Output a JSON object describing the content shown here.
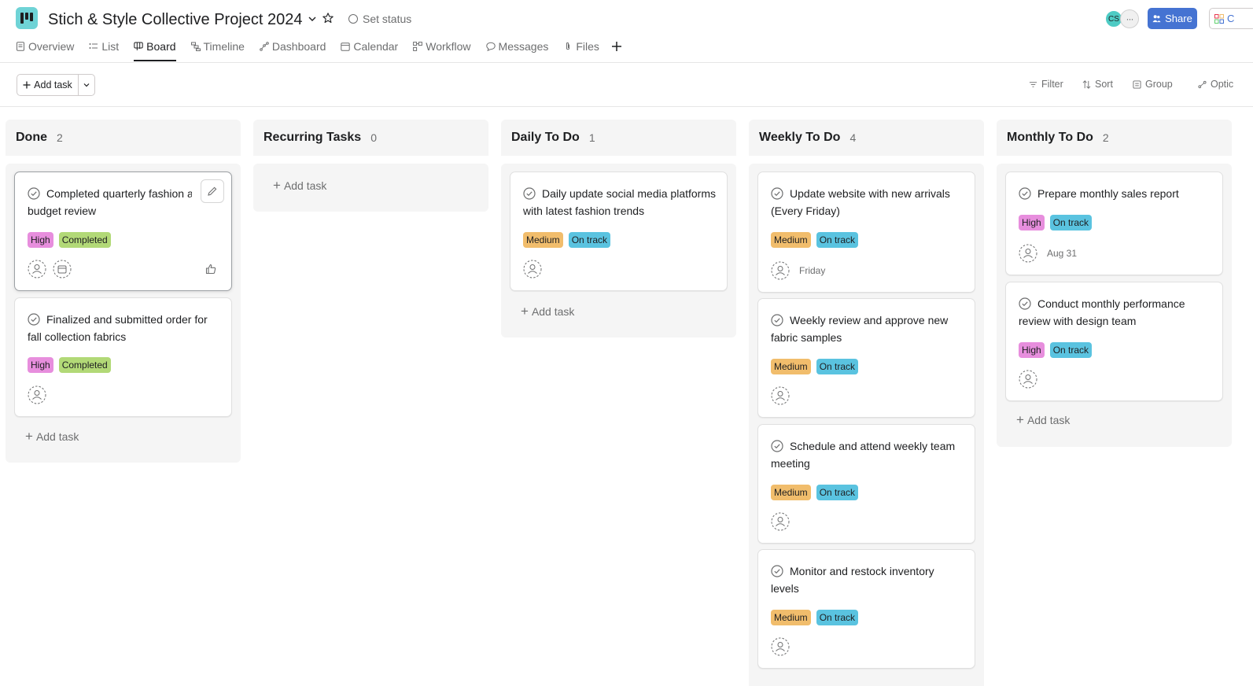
{
  "header": {
    "title": "Stich & Style Collective Project 2024",
    "set_status": "Set status",
    "avatar_initials": "CS",
    "share_label": "Share",
    "customize_label": "C"
  },
  "tabs": [
    {
      "label": "Overview",
      "icon": "overview-icon",
      "active": false
    },
    {
      "label": "List",
      "icon": "list-icon",
      "active": false
    },
    {
      "label": "Board",
      "icon": "board-icon",
      "active": true
    },
    {
      "label": "Timeline",
      "icon": "timeline-icon",
      "active": false
    },
    {
      "label": "Dashboard",
      "icon": "dashboard-icon",
      "active": false
    },
    {
      "label": "Calendar",
      "icon": "calendar-icon",
      "active": false
    },
    {
      "label": "Workflow",
      "icon": "workflow-icon",
      "active": false
    },
    {
      "label": "Messages",
      "icon": "message-icon",
      "active": false
    },
    {
      "label": "Files",
      "icon": "attachment-icon",
      "active": false
    }
  ],
  "toolbar": {
    "add_task": "Add task",
    "filter": "Filter",
    "sort": "Sort",
    "group": "Group",
    "options": "Optic"
  },
  "board": {
    "add_task_label": "Add task",
    "columns": [
      {
        "title": "Done",
        "count": "2",
        "cards": [
          {
            "title": "Completed quarterly fashion asset budget review",
            "priority": "High",
            "status": "Completed",
            "due": ""
          },
          {
            "title": "Finalized and submitted order for fall collection fabrics",
            "priority": "High",
            "status": "Completed",
            "due": ""
          }
        ]
      },
      {
        "title": "Recurring Tasks",
        "count": "0",
        "cards": []
      },
      {
        "title": "Daily To Do",
        "count": "1",
        "cards": [
          {
            "title": "Daily update social media platforms with latest fashion trends",
            "priority": "Medium",
            "status": "On track",
            "due": ""
          }
        ]
      },
      {
        "title": "Weekly To Do",
        "count": "4",
        "cards": [
          {
            "title": "Update website with new arrivals (Every Friday)",
            "priority": "Medium",
            "status": "On track",
            "due": "Friday"
          },
          {
            "title": "Weekly review and approve new fabric samples",
            "priority": "Medium",
            "status": "On track",
            "due": ""
          },
          {
            "title": "Schedule and attend weekly team meeting",
            "priority": "Medium",
            "status": "On track",
            "due": ""
          },
          {
            "title": "Monitor and restock inventory levels",
            "priority": "Medium",
            "status": "On track",
            "due": ""
          }
        ]
      },
      {
        "title": "Monthly To Do",
        "count": "2",
        "cards": [
          {
            "title": "Prepare monthly sales report",
            "priority": "High",
            "status": "On track",
            "due": "Aug 31"
          },
          {
            "title": "Conduct monthly performance review with design team",
            "priority": "High",
            "status": "On track",
            "due": ""
          }
        ]
      }
    ]
  },
  "colors": {
    "accent": "#4573d2",
    "tag_high": "#e78edd",
    "tag_medium": "#f1bd6c",
    "tag_completed": "#b2d977",
    "tag_on_track": "#5ac3e0",
    "column_bg": "#f5f5f5"
  }
}
